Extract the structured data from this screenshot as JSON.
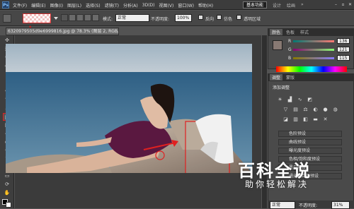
{
  "app": {
    "logo": "Ps",
    "zoom": "78.3"
  },
  "menu": [
    "文件(F)",
    "编辑(E)",
    "图像(I)",
    "图层(L)",
    "选择(S)",
    "滤镜(T)",
    "分析(A)",
    "3D(D)",
    "视图(V)",
    "窗口(W)",
    "帮助(H)"
  ],
  "workspace": {
    "active": "基本功能",
    "items": [
      "设计",
      "绘画",
      "»"
    ]
  },
  "options": {
    "mode_label": "模式:",
    "mode_value": "正常",
    "opacity_label": "不透明度:",
    "opacity_value": "100%",
    "reverse": "反向",
    "dither": "仿色",
    "transparency": "透明区域"
  },
  "document": {
    "tab_title": "6320979505d9e6999816.jpg @ 78.3% (图层 2, RGB/8#) ×"
  },
  "panels": {
    "color_tab": "颜色",
    "swatches_tab": "色板",
    "styles_tab": "样式",
    "color": {
      "r_label": "R",
      "g_label": "G",
      "b_label": "B",
      "r": "136",
      "g": "121",
      "b": "115"
    },
    "adjust_tab": "调整",
    "masks_tab": "蒙版",
    "adjust_title": "添加调整",
    "presets": [
      "色阶预设",
      "曲线预设",
      "曝光度预设",
      "色相/饱和度预设",
      "黑白预设",
      "通道混合器预设"
    ],
    "layers_mode": "正常",
    "layers_opacity_label": "不透明度:",
    "layers_opacity": "31%"
  },
  "watermark": {
    "title": "百科全说",
    "subtitle": "助你轻松解决"
  },
  "colors": {
    "accent_red": "#e02020",
    "panel_bg": "#535353",
    "menubar": "#3c3c3c"
  }
}
